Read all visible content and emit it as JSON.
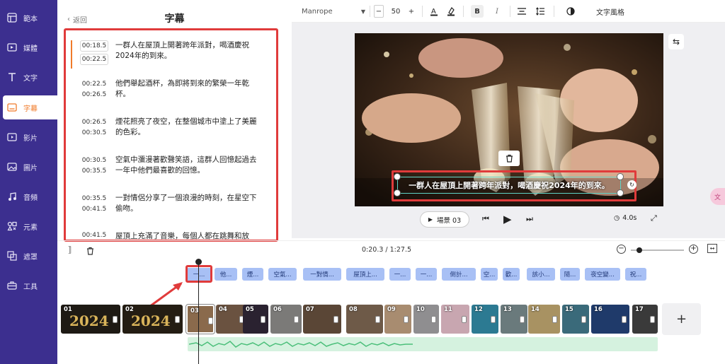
{
  "sidebar": {
    "items": [
      {
        "label": "範本",
        "icon": "template-icon"
      },
      {
        "label": "媒體",
        "icon": "media-icon"
      },
      {
        "label": "文字",
        "icon": "text-icon"
      },
      {
        "label": "字幕",
        "icon": "subtitle-icon"
      },
      {
        "label": "影片",
        "icon": "video-icon"
      },
      {
        "label": "圖片",
        "icon": "image-icon"
      },
      {
        "label": "音頻",
        "icon": "audio-icon"
      },
      {
        "label": "元素",
        "icon": "elements-icon"
      },
      {
        "label": "遮罩",
        "icon": "mask-icon"
      },
      {
        "label": "工具",
        "icon": "tools-icon"
      }
    ],
    "active_index": 3
  },
  "panel": {
    "back_label": "返回",
    "title": "字幕",
    "subtitles": [
      {
        "start": "00:18.5",
        "end": "00:22.5",
        "text": "一群人在屋頂上開著跨年派對，喝酒慶祝2024年的到來。"
      },
      {
        "start": "00:22.5",
        "end": "00:26.5",
        "text": "他們舉起酒杯，為即將到來的繁榮一年乾杯。"
      },
      {
        "start": "00:26.5",
        "end": "00:30.5",
        "text": "煙花照亮了夜空，在整個城市中塗上了美麗的色彩。"
      },
      {
        "start": "00:30.5",
        "end": "00:35.5",
        "text": "空氣中瀰漫著歡聲笑語，這群人回憶起過去一年中他們最喜歡的回憶。"
      },
      {
        "start": "00:35.5",
        "end": "00:41.5",
        "text": "一對情侶分享了一個浪漫的時刻，在星空下偷吻。"
      },
      {
        "start": "00:41.5",
        "end": "",
        "text": "屋頂上充滿了音樂，每個人都在跳舞和放"
      }
    ]
  },
  "toolbar": {
    "font": "Manrope",
    "font_size": "50",
    "minus": "−",
    "plus": "+",
    "bold": "B",
    "italic": "I",
    "style_label": "文字風格"
  },
  "canvas": {
    "caption": "一群人在屋頂上開著跨年派對，喝酒慶祝2024年的到來。"
  },
  "player": {
    "scene_label": "場景 03",
    "duration": "4.0s",
    "timecode": "0:20.3 / 1:27.5"
  },
  "timeline": {
    "subtitle_chips": [
      "一...",
      "他...",
      "煙...",
      "空氣...",
      "一對情...",
      "屋頂上...",
      "一...",
      "一...",
      "倒計...",
      "空...",
      "歡...",
      "該小...",
      "隨...",
      "夜空變...",
      "祝..."
    ],
    "clips": [
      "01",
      "02",
      "03",
      "04",
      "05",
      "06",
      "07",
      "08",
      "09",
      "10",
      "11",
      "12",
      "13",
      "14",
      "15",
      "16",
      "17"
    ],
    "add_label": "+"
  },
  "colors": {
    "sidebar_bg": "#3c2f8f",
    "accent": "#f07b2a",
    "highlight": "#e03b3b",
    "subtitle_chip": "#a8c0f5",
    "audio_track": "#d5f2df"
  }
}
